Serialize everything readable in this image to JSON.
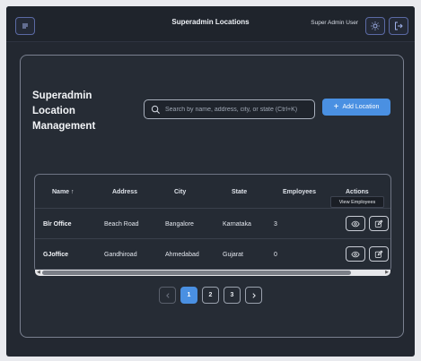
{
  "header": {
    "title": "Superadmin Locations",
    "user_name": "Super Admin User"
  },
  "page": {
    "heading": "Superadmin Location Management",
    "search_placeholder": "Search by name, address, city, or state (Ctrl+K)",
    "add_label": "Add Location"
  },
  "table": {
    "columns": [
      "Name ↑",
      "Address",
      "City",
      "State",
      "Employees",
      "Actions"
    ],
    "rows": [
      {
        "name": "Blr Office",
        "address": "Beach Road",
        "city": "Bangalore",
        "state": "Karnataka",
        "employees": "3"
      },
      {
        "name": "GJoffice",
        "address": "Gandhiroad",
        "city": "Ahmedabad",
        "state": "Gujarat",
        "employees": "0"
      }
    ],
    "tooltip": "View Employees"
  },
  "pagination": {
    "pages": [
      "1",
      "2",
      "3"
    ],
    "current": "1"
  },
  "colors": {
    "accent": "#4a90e2",
    "background": "#232831"
  }
}
